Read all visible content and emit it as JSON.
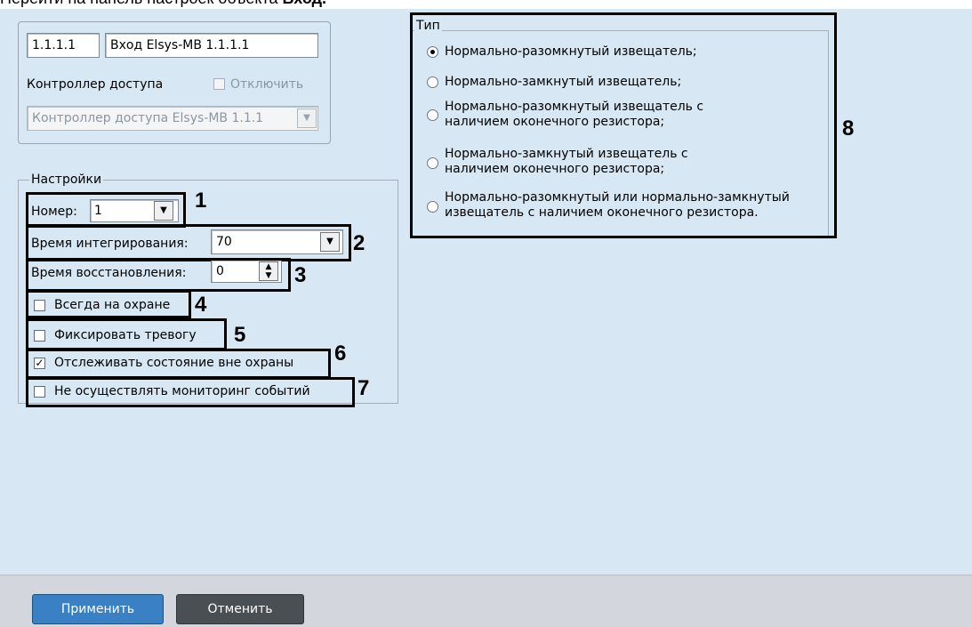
{
  "caption": {
    "text": "Перейти на панель настроек объекта ",
    "bold": "Вход."
  },
  "controller": {
    "id": "1.1.1.1",
    "name": "Вход Elsys-MB 1.1.1.1",
    "parent_label": "Контроллер доступа",
    "disable_label": "Отключить",
    "parent_value": "Контроллер доступа Elsys-MB 1.1.1"
  },
  "settings": {
    "legend": "Настройки",
    "number_label": "Номер:",
    "number_value": "1",
    "integration_label": "Время интегрирования:",
    "integration_value": "70",
    "restore_label": "Время восстановления:",
    "restore_value": "0",
    "always_armed": {
      "label": "Всегда на охране",
      "checked": false
    },
    "fix_alarm": {
      "label": "Фиксировать тревогу",
      "checked": false
    },
    "track_state": {
      "label": "Отслеживать состояние вне охраны",
      "checked": true
    },
    "no_monitoring": {
      "label": "Не осуществлять мониторинг событий",
      "checked": false
    }
  },
  "type": {
    "legend": "Тип",
    "options": [
      {
        "line1": "Нормально-разомкнутый извещатель;",
        "line2": "",
        "checked": true
      },
      {
        "line1": "Нормально-замкнутый извещатель;",
        "line2": "",
        "checked": false
      },
      {
        "line1": "Нормально-разомкнутый извещатель с",
        "line2": "наличием оконечного резистора;",
        "checked": false
      },
      {
        "line1": "Нормально-замкнутый извещатель с",
        "line2": "наличием оконечного резистора;",
        "checked": false
      },
      {
        "line1": "Нормально-разомкнутый или нормально-замкнутый",
        "line2": "извещатель с наличием оконечного резистора.",
        "checked": false
      }
    ]
  },
  "annotations": [
    "1",
    "2",
    "3",
    "4",
    "5",
    "6",
    "7",
    "8"
  ],
  "buttons": {
    "apply": "Применить",
    "cancel": "Отменить"
  },
  "colors": {
    "panel": "#d7e7f4",
    "footer": "#d3d6dc",
    "apply": "#3a80c4",
    "cancel": "#4a4f54"
  }
}
